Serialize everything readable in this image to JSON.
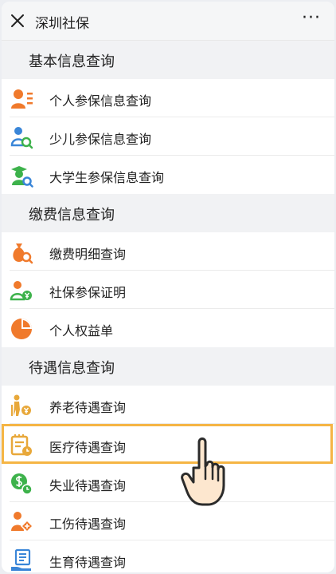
{
  "header": {
    "title": "深圳社保",
    "more": "···"
  },
  "sections": [
    {
      "title": "基本信息查询",
      "items": [
        {
          "label": "个人参保信息查询",
          "icon": "person-list-icon"
        },
        {
          "label": "少儿参保信息查询",
          "icon": "child-search-icon"
        },
        {
          "label": "大学生参保信息查询",
          "icon": "graduate-search-icon"
        }
      ]
    },
    {
      "title": "缴费信息查询",
      "items": [
        {
          "label": "缴费明细查询",
          "icon": "money-bag-search-icon"
        },
        {
          "label": "社保参保证明",
          "icon": "person-yuan-icon"
        },
        {
          "label": "个人权益单",
          "icon": "pie-chart-icon"
        }
      ]
    },
    {
      "title": "待遇信息查询",
      "items": [
        {
          "label": "养老待遇查询",
          "icon": "elderly-yuan-icon"
        },
        {
          "label": "医疗待遇查询",
          "icon": "medical-record-icon"
        },
        {
          "label": "失业待遇查询",
          "icon": "coin-clock-icon"
        },
        {
          "label": "工伤待遇查询",
          "icon": "injury-cross-icon"
        },
        {
          "label": "生育待遇查询",
          "icon": "document-hand-icon"
        }
      ]
    }
  ],
  "colors": {
    "orange": "#f07a2c",
    "green": "#3db24b",
    "blue": "#3a86d8",
    "highlight": "#f5b544",
    "gold": "#e8a83a"
  }
}
